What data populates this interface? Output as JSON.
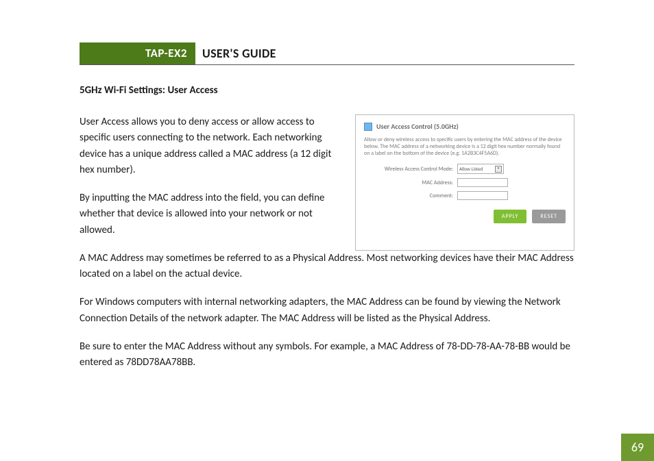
{
  "header": {
    "badge": "TAP-EX2",
    "title": "USER'S GUIDE"
  },
  "section_heading": "5GHz Wi-Fi Settings: User Access",
  "paragraphs": {
    "p1": "User Access allows you to deny access or allow access to specific users connecting to the network. Each networking device has a unique address called a MAC address (a 12 digit hex number).",
    "p2": "By inputting the MAC address into the field, you can define whether that device is allowed into your network or not allowed.",
    "p3": "A MAC Address may sometimes be referred to as a Physical Address. Most networking devices have their MAC Address located on a label on the actual device.",
    "p4": "For Windows computers with internal networking adapters, the MAC Address can be found by viewing the Network Connection Details of the network adapter. The MAC Address will be listed as the Physical Address.",
    "p5": "Be sure to enter the MAC Address without any symbols. For example, a MAC Address of 78-DD-78-AA-78-BB would be entered as 78DD78AA78BB."
  },
  "panel": {
    "title": "User Access Control (5.0GHz)",
    "desc": "Allow or deny wireless access to specific users by entering the MAC address of the device below. The MAC address of a networking device is a 12 digit hex number normally found on a label on the bottom of the device (e.g. 1A2B3C4F5A6D).",
    "fields": {
      "mode_label": "Wireless Access Control Mode:",
      "mode_value": "Allow Listed",
      "mac_label": "MAC Address:",
      "comment_label": "Comment:"
    },
    "buttons": {
      "apply": "APPLY",
      "reset": "RESET"
    }
  },
  "page_number": "69"
}
